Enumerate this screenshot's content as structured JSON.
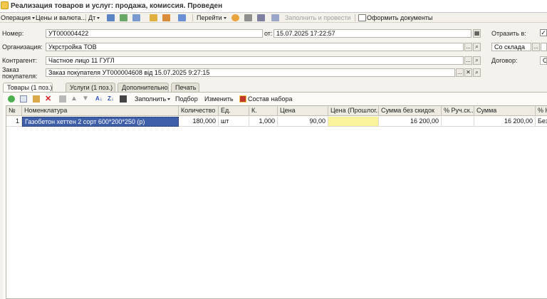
{
  "window": {
    "title": "Реализация товаров и услуг: продажа, комиссия. Проведен"
  },
  "toolbar": {
    "operation": "Операция",
    "prices": "Цены и валюта...",
    "dt": "Дт",
    "goto": "Перейти",
    "fill_post": "Заполнить и провести",
    "make_docs": "Оформить документы"
  },
  "form": {
    "number_label": "Номер:",
    "number": "УТ000004422",
    "from_label": "от:",
    "date": "15.07.2025 17:22:57",
    "reflect_label": "Отразить в:",
    "reflect_checked": "✓",
    "org_label": "Организация:",
    "org": "Укрстройка ТОВ",
    "warehouse": "Со склада",
    "counterparty_label": "Контрагент:",
    "counterparty": "Частное лицо 11 ГУГЛ",
    "contract_label": "Договор:",
    "contract": "О",
    "order_label_1": "Заказ",
    "order_label_2": "покупателя:",
    "order": "Заказ покупателя УТ000004608 від 15.07.2025 9:27:15"
  },
  "tabs": [
    {
      "label": "Товары (1 поз.)"
    },
    {
      "label": "Услуги (1 поз.)"
    },
    {
      "label": "Дополнительно"
    },
    {
      "label": "Печать"
    }
  ],
  "tab_toolbar": {
    "fill": "Заполнить",
    "selection": "Подбор",
    "change": "Изменить",
    "kit": "Состав набора"
  },
  "table": {
    "columns": [
      "№",
      "Номенклатура",
      "Количество",
      "Ед.",
      "К.",
      "Цена",
      "Цена (Прошлог...",
      "Сумма без скидок",
      "% Руч.ск..",
      "Сумма",
      "% Н"
    ],
    "rows": [
      [
        "1",
        "Газобетон хеттен 2 сорт 600*200*250 (р)",
        "180,000",
        "шт",
        "1,000",
        "90,00",
        "",
        "16 200,00",
        "",
        "16 200,00",
        "Без"
      ]
    ]
  },
  "colors": {
    "selection": "#3f5fa8",
    "highlight": "#fbf39b",
    "accent": "#f2c94c"
  }
}
